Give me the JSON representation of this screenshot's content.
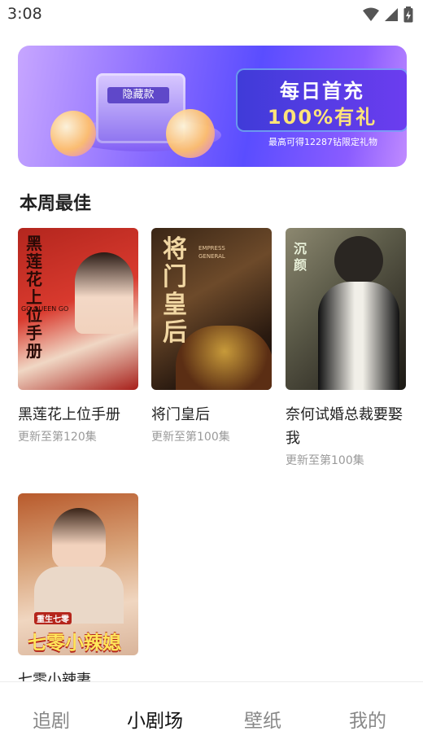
{
  "status_bar": {
    "time": "3:08"
  },
  "banner": {
    "box_tag": "隐藏款",
    "line1": "每日首充",
    "line2": "100%有礼",
    "sub": "最高可得12287钻限定礼物"
  },
  "section": {
    "title": "本周最佳"
  },
  "cards": [
    {
      "title": "黑莲花上位手册",
      "subtitle": "更新至第120集",
      "poster_text": "黑莲花上位手册",
      "poster_small": "GO QUEEN GO"
    },
    {
      "title": "将门皇后",
      "subtitle": "更新至第100集",
      "poster_text": "将门皇后",
      "poster_small": "EMPRESS GENERAL"
    },
    {
      "title": "奈何试婚总裁要娶我",
      "subtitle": "更新至第100集",
      "poster_text": "沉颜"
    },
    {
      "title": "七零小辣妻",
      "subtitle": "",
      "poster_text": "七零小辣媳",
      "poster_small": "重生七零"
    }
  ],
  "tabbar": {
    "tabs": [
      {
        "label": "追剧"
      },
      {
        "label": "小剧场"
      },
      {
        "label": "壁纸"
      },
      {
        "label": "我的"
      }
    ],
    "active_index": 1
  },
  "colors": {
    "accent": "#6a4dff",
    "text": "#222222",
    "muted": "#9a9a9a"
  }
}
